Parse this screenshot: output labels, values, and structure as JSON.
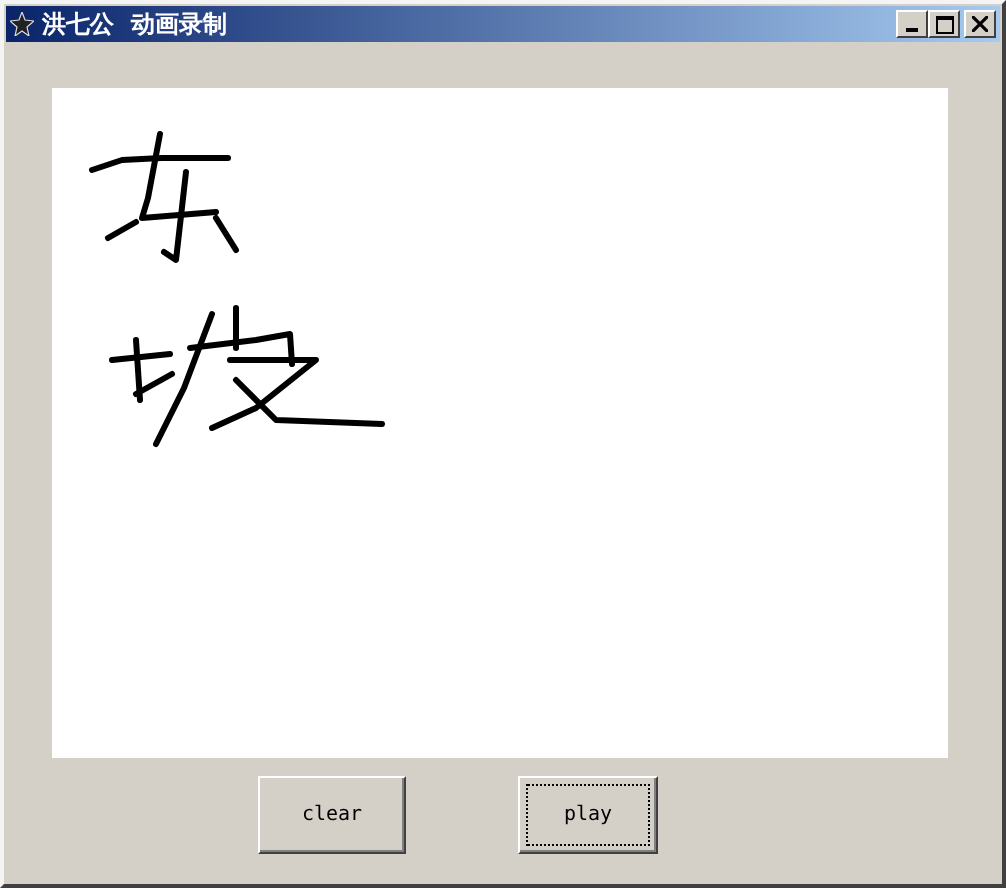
{
  "window": {
    "title": "洪七公  动画录制"
  },
  "buttons": [
    {
      "label": "clear",
      "focused": false
    },
    {
      "label": "play",
      "focused": true
    }
  ]
}
